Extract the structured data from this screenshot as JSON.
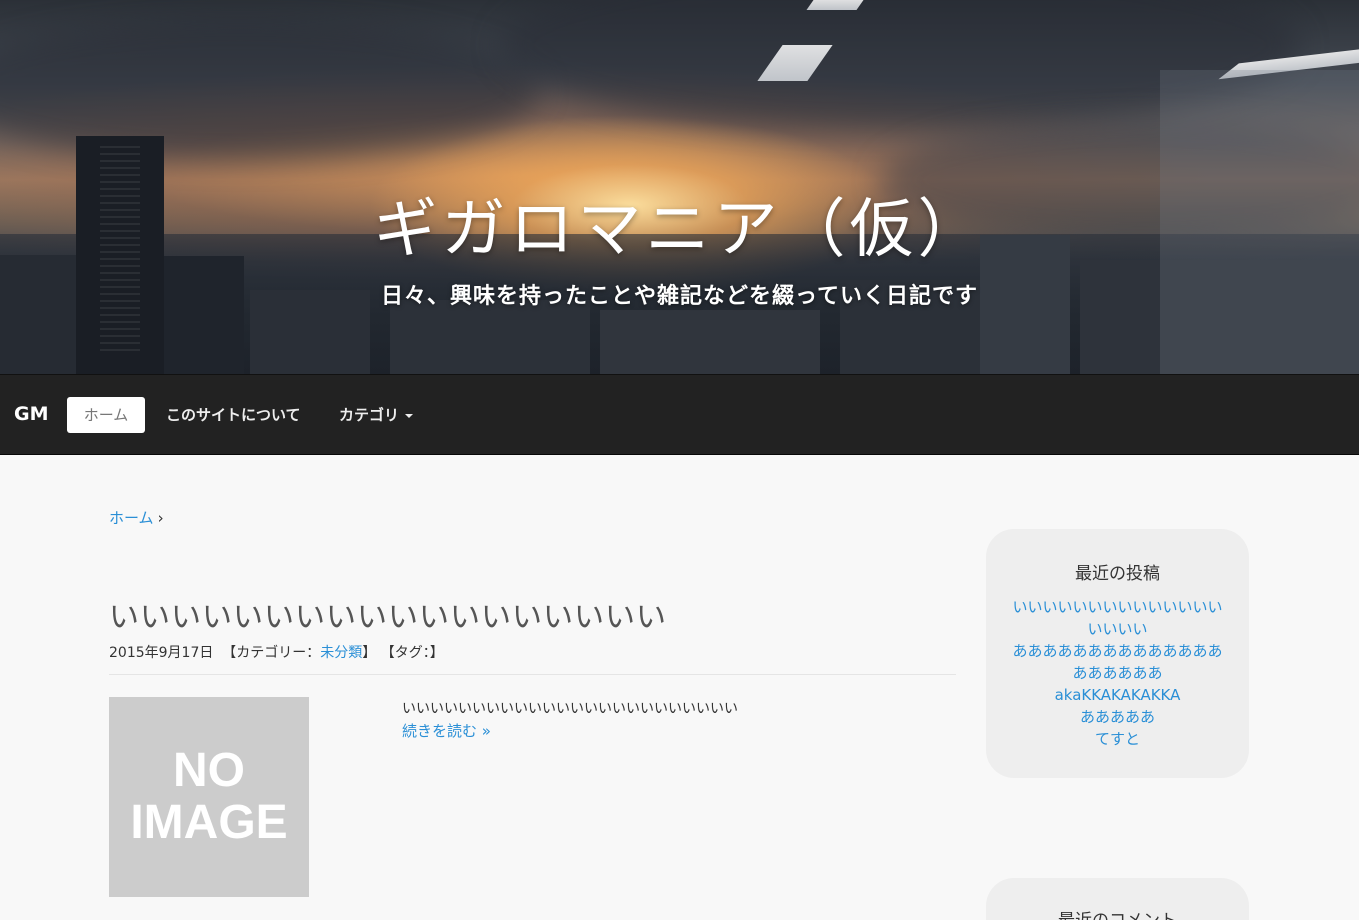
{
  "site": {
    "title": "ギガロマニア（仮）",
    "tagline": "日々、興味を持ったことや雑記などを綴っていく日記です"
  },
  "navbar": {
    "brand": "GM",
    "items": [
      {
        "label": "ホーム",
        "active": true
      },
      {
        "label": "このサイトについて"
      },
      {
        "label": "カテゴリ",
        "dropdown": true
      }
    ]
  },
  "breadcrumb": {
    "home": "ホーム",
    "separator": "›"
  },
  "post": {
    "title": "いいいいいいいいいいいいいいいいいい",
    "date": "2015年9月17日",
    "category_prefix": "【カテゴリー：",
    "category": "未分類",
    "category_suffix": "】",
    "tags": "【タグ：】",
    "thumbnail_text": "NO\nIMAGE",
    "excerpt": "いいいいいいいいいいいいいいいいいいいいいいいい",
    "read_more": "続きを読む »"
  },
  "sidebar": {
    "recent_posts": {
      "title": "最近の投稿",
      "items": [
        "いいいいいいいいいいいいいいいいいい",
        "ああああああああああああああああああああ",
        "akaKKAKAKAKKA",
        "あああああ",
        "てすと"
      ]
    },
    "recent_comments": {
      "title": "最近のコメント"
    }
  },
  "colors": {
    "link": "#2a8fd6",
    "navbar_bg": "#222222",
    "page_bg": "#f8f8f8",
    "widget_bg": "#eeeeee",
    "thumb_bg": "#cccccc"
  }
}
